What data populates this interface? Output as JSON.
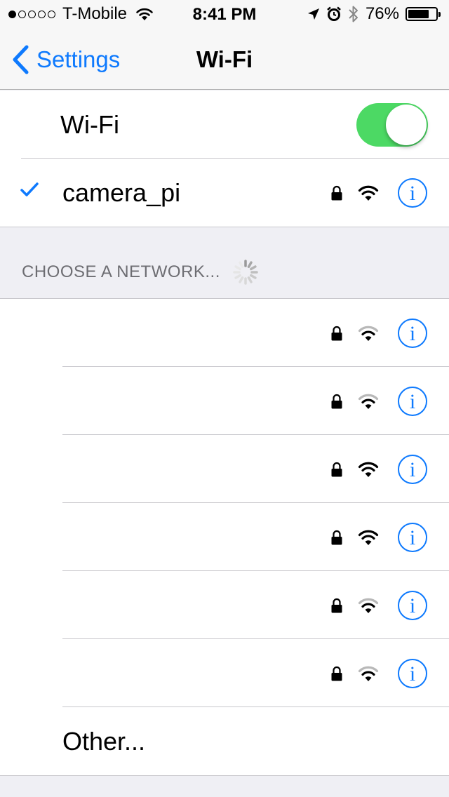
{
  "status_bar": {
    "carrier": "T-Mobile",
    "signal_bars": 1,
    "signal_total": 5,
    "time": "8:41 PM",
    "battery_percent": "76%",
    "battery_level": 0.76
  },
  "nav": {
    "back_label": "Settings",
    "title": "Wi-Fi"
  },
  "wifi_toggle": {
    "label": "Wi-Fi",
    "on": true,
    "color": "#4cd964"
  },
  "connected_network": {
    "name": "camera_pi",
    "secured": true,
    "signal": "strong"
  },
  "choose_network": {
    "header": "CHOOSE A NETWORK..."
  },
  "networks": [
    {
      "name": "",
      "secured": true,
      "signal": "weak"
    },
    {
      "name": "",
      "secured": true,
      "signal": "weak"
    },
    {
      "name": "",
      "secured": true,
      "signal": "strong"
    },
    {
      "name": "",
      "secured": true,
      "signal": "strong"
    },
    {
      "name": "",
      "secured": true,
      "signal": "weak"
    },
    {
      "name": "",
      "secured": true,
      "signal": "weak"
    }
  ],
  "other": {
    "label": "Other..."
  },
  "colors": {
    "accent": "#0e7afe",
    "toggle_on": "#4cd964",
    "background": "#efeff4",
    "separator": "#c8c7cc"
  }
}
